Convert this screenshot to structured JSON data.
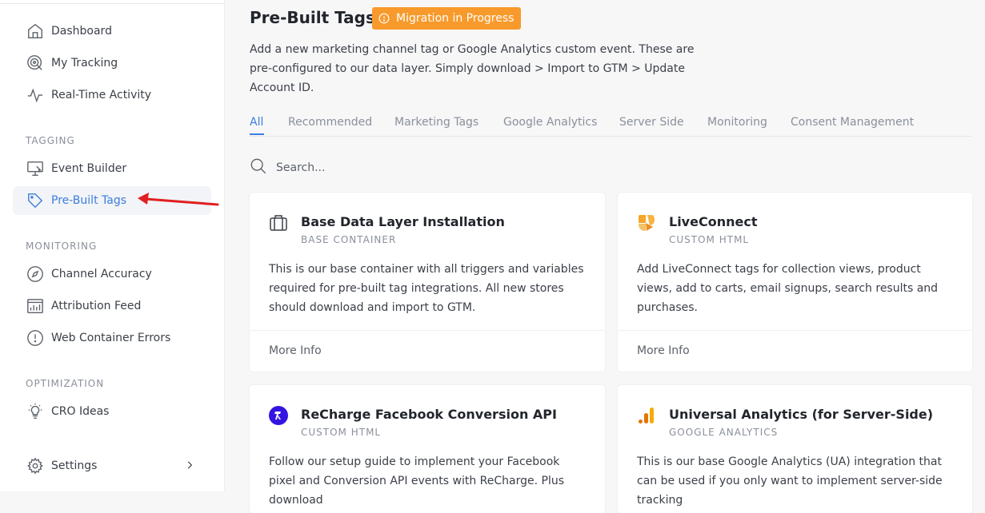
{
  "sidebar": {
    "items_top": [
      {
        "label": "Dashboard",
        "icon": "home-icon"
      },
      {
        "label": "My Tracking",
        "icon": "tracking-icon"
      },
      {
        "label": "Real-Time Activity",
        "icon": "activity-icon"
      }
    ],
    "tagging_label": "TAGGING",
    "tagging_items": [
      {
        "label": "Event Builder",
        "icon": "monitor-icon"
      },
      {
        "label": "Pre-Built Tags",
        "icon": "tag-icon",
        "active": true
      }
    ],
    "monitoring_label": "MONITORING",
    "monitoring_items": [
      {
        "label": "Channel Accuracy",
        "icon": "compass-icon"
      },
      {
        "label": "Attribution Feed",
        "icon": "chart-icon"
      },
      {
        "label": "Web Container Errors",
        "icon": "alert-icon"
      }
    ],
    "optimization_label": "OPTIMIZATION",
    "optimization_items": [
      {
        "label": "CRO Ideas",
        "icon": "lightbulb-icon"
      }
    ],
    "settings": {
      "label": "Settings",
      "icon": "gear-icon"
    }
  },
  "header": {
    "title": "Pre-Built Tags",
    "badge": "Migration in Progress",
    "description": "Add a new marketing channel tag or Google Analytics custom event. These are pre-configured to our data layer. Simply download > Import to GTM > Update Account ID."
  },
  "tabs": [
    "All",
    "Recommended",
    "Marketing Tags",
    "Google Analytics",
    "Server Side",
    "Monitoring",
    "Consent Management"
  ],
  "search": {
    "placeholder": "Search..."
  },
  "cards": [
    {
      "title": "Base Data Layer Installation",
      "subtitle": "BASE CONTAINER",
      "description": "This is our base container with all triggers and variables required for pre-built tag integrations. All new stores should download and import to GTM.",
      "more": "More Info",
      "icon": "briefcase-icon"
    },
    {
      "title": "LiveConnect",
      "subtitle": "CUSTOM HTML",
      "description": "Add LiveConnect tags for collection views, product views, add to carts, email signups, search results and purchases.",
      "more": "More Info",
      "icon": "liveconnect-logo-icon"
    },
    {
      "title": "ReCharge Facebook Conversion API",
      "subtitle": "CUSTOM HTML",
      "description": "Follow our setup guide to implement your Facebook pixel and Conversion API events with ReCharge. Plus download",
      "icon": "recharge-logo-icon"
    },
    {
      "title": "Universal Analytics (for Server-Side)",
      "subtitle": "GOOGLE ANALYTICS",
      "description": "This is our base Google Analytics (UA) integration that can be used if you only want to implement server-side tracking",
      "icon": "google-analytics-icon"
    }
  ],
  "colors": {
    "accent": "#3b7ddd",
    "badge": "#f89a2b",
    "arrow": "#e02020"
  }
}
